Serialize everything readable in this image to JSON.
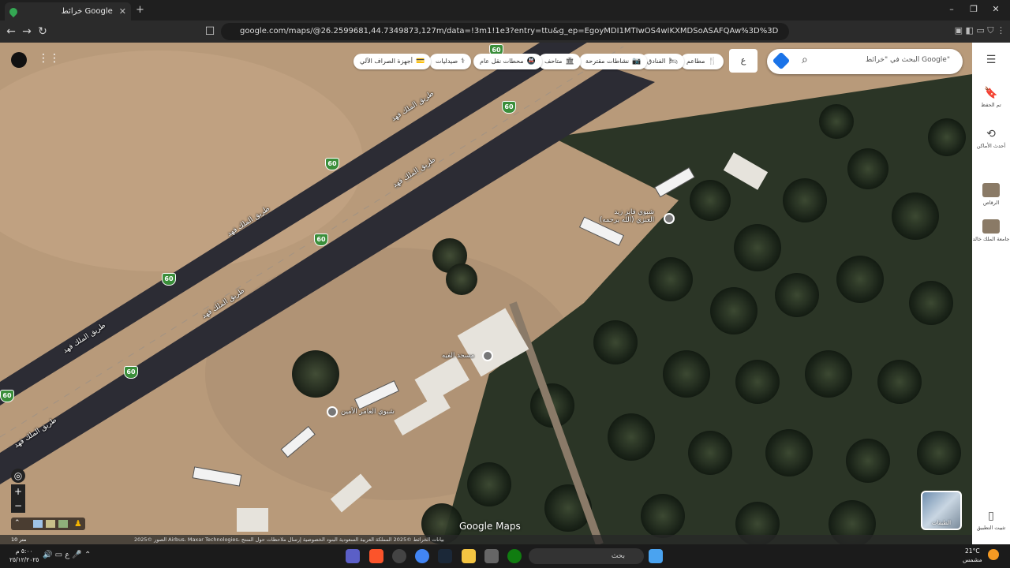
{
  "browser": {
    "tab_title": "خرائط Google",
    "tab_close": "✕",
    "new_tab": "+",
    "url": "google.com/maps/@26.2599681,44.7349873,127m/data=!3m1!1e3?entry=ttu&g_ep=EgoyMDI1MTIwOS4wIKXMDSoASAFQAw%3D%3D",
    "window_controls": [
      "–",
      "❐",
      "✕"
    ],
    "nav": [
      "←",
      "→",
      "↻"
    ]
  },
  "search": {
    "placeholder": "البحث في \"خرائط Google\"",
    "lang": "ع"
  },
  "chips": [
    {
      "label": "مطاعم",
      "icon": "🍴"
    },
    {
      "label": "الفنادق",
      "icon": "🛏"
    },
    {
      "label": "نشاطات مقترحة",
      "icon": "📷"
    },
    {
      "label": "متاحف",
      "icon": "🏛"
    },
    {
      "label": "محطات نقل عام",
      "icon": "🚇"
    },
    {
      "label": "صيدليات",
      "icon": "⚕"
    },
    {
      "label": "أجهزة الصراف الآلي",
      "icon": "💳"
    }
  ],
  "map": {
    "road_name": "طريق الملك فهد",
    "shield_number": "60",
    "places": [
      {
        "name": "شبوي فايز زيد",
        "sub": "العنزي (الله يرحمه)"
      },
      {
        "name": "مسجد الفيه"
      },
      {
        "name": "شبوي العامر الأمين"
      }
    ],
    "watermark": "Google Maps",
    "attribution": "الصور ©2025 Airbus، Maxar Technologies، بيانات الخرائط ©2025   المملكة العربية السعودية   البنود   الخصوصية   إرسال ملاحظات حول المنتج",
    "scale": "10 متر",
    "layers_label": "الطبقات"
  },
  "rail": {
    "saved": "تم الحفظ",
    "recent": "أحدث الأماكن",
    "item1": "الرقاص",
    "item2": "جامعة الملك خالد",
    "install": "تثبيت التطبيق"
  },
  "taskbar": {
    "search": "بحث",
    "time_left": "٥:٠٠ م",
    "date_left": "٢٥/١٢/٢٠٢٥",
    "temp": "21°C",
    "weather": "مشمس"
  },
  "colors": {
    "road": "#2c2c34",
    "shield": "#3a8e3a",
    "sand": "#b89a7a",
    "palm": "#1f2e1f"
  }
}
